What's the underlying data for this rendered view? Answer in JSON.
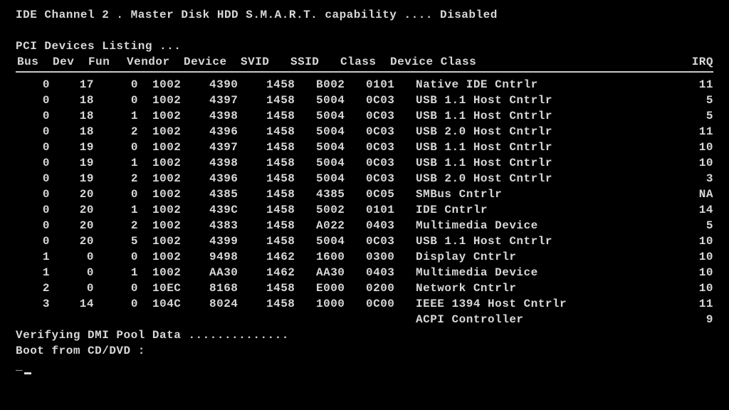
{
  "ide_line": "IDE Channel 2 . Master Disk  HDD S.M.A.R.T. capability .... Disabled",
  "pci_heading": "PCI Devices Listing ...",
  "columns": {
    "bus": "Bus",
    "dev": "Dev",
    "fun": "Fun",
    "vendor": "Vendor",
    "device": "Device",
    "svid": "SVID",
    "ssid": "SSID",
    "class": "Class",
    "device_class": "Device Class",
    "irq": "IRQ"
  },
  "rows": [
    {
      "bus": "0",
      "dev": "17",
      "fun": "0",
      "vendor": "1002",
      "device": "4390",
      "svid": "1458",
      "ssid": "B002",
      "class": "0101",
      "dclass": "Native IDE Cntrlr",
      "irq": "11"
    },
    {
      "bus": "0",
      "dev": "18",
      "fun": "0",
      "vendor": "1002",
      "device": "4397",
      "svid": "1458",
      "ssid": "5004",
      "class": "0C03",
      "dclass": "USB 1.1 Host Cntrlr",
      "irq": "5"
    },
    {
      "bus": "0",
      "dev": "18",
      "fun": "1",
      "vendor": "1002",
      "device": "4398",
      "svid": "1458",
      "ssid": "5004",
      "class": "0C03",
      "dclass": "USB 1.1 Host Cntrlr",
      "irq": "5"
    },
    {
      "bus": "0",
      "dev": "18",
      "fun": "2",
      "vendor": "1002",
      "device": "4396",
      "svid": "1458",
      "ssid": "5004",
      "class": "0C03",
      "dclass": "USB 2.0 Host Cntrlr",
      "irq": "11"
    },
    {
      "bus": "0",
      "dev": "19",
      "fun": "0",
      "vendor": "1002",
      "device": "4397",
      "svid": "1458",
      "ssid": "5004",
      "class": "0C03",
      "dclass": "USB 1.1 Host Cntrlr",
      "irq": "10"
    },
    {
      "bus": "0",
      "dev": "19",
      "fun": "1",
      "vendor": "1002",
      "device": "4398",
      "svid": "1458",
      "ssid": "5004",
      "class": "0C03",
      "dclass": "USB 1.1 Host Cntrlr",
      "irq": "10"
    },
    {
      "bus": "0",
      "dev": "19",
      "fun": "2",
      "vendor": "1002",
      "device": "4396",
      "svid": "1458",
      "ssid": "5004",
      "class": "0C03",
      "dclass": "USB 2.0 Host Cntrlr",
      "irq": "3"
    },
    {
      "bus": "0",
      "dev": "20",
      "fun": "0",
      "vendor": "1002",
      "device": "4385",
      "svid": "1458",
      "ssid": "4385",
      "class": "0C05",
      "dclass": "SMBus Cntrlr",
      "irq": "NA"
    },
    {
      "bus": "0",
      "dev": "20",
      "fun": "1",
      "vendor": "1002",
      "device": "439C",
      "svid": "1458",
      "ssid": "5002",
      "class": "0101",
      "dclass": "IDE Cntrlr",
      "irq": "14"
    },
    {
      "bus": "0",
      "dev": "20",
      "fun": "2",
      "vendor": "1002",
      "device": "4383",
      "svid": "1458",
      "ssid": "A022",
      "class": "0403",
      "dclass": "Multimedia Device",
      "irq": "5"
    },
    {
      "bus": "0",
      "dev": "20",
      "fun": "5",
      "vendor": "1002",
      "device": "4399",
      "svid": "1458",
      "ssid": "5004",
      "class": "0C03",
      "dclass": "USB 1.1 Host Cntrlr",
      "irq": "10"
    },
    {
      "bus": "1",
      "dev": "0",
      "fun": "0",
      "vendor": "1002",
      "device": "9498",
      "svid": "1462",
      "ssid": "1600",
      "class": "0300",
      "dclass": "Display Cntrlr",
      "irq": "10"
    },
    {
      "bus": "1",
      "dev": "0",
      "fun": "1",
      "vendor": "1002",
      "device": "AA30",
      "svid": "1462",
      "ssid": "AA30",
      "class": "0403",
      "dclass": "Multimedia Device",
      "irq": "10"
    },
    {
      "bus": "2",
      "dev": "0",
      "fun": "0",
      "vendor": "10EC",
      "device": "8168",
      "svid": "1458",
      "ssid": "E000",
      "class": "0200",
      "dclass": "Network Cntrlr",
      "irq": "10"
    },
    {
      "bus": "3",
      "dev": "14",
      "fun": "0",
      "vendor": "104C",
      "device": "8024",
      "svid": "1458",
      "ssid": "1000",
      "class": "0C00",
      "dclass": "IEEE 1394 Host Cntrlr",
      "irq": "11"
    }
  ],
  "acpi": {
    "label": "ACPI Controller",
    "irq": "9"
  },
  "verify_line": "Verifying DMI Pool Data ..............",
  "boot_line": "Boot from CD/DVD :"
}
